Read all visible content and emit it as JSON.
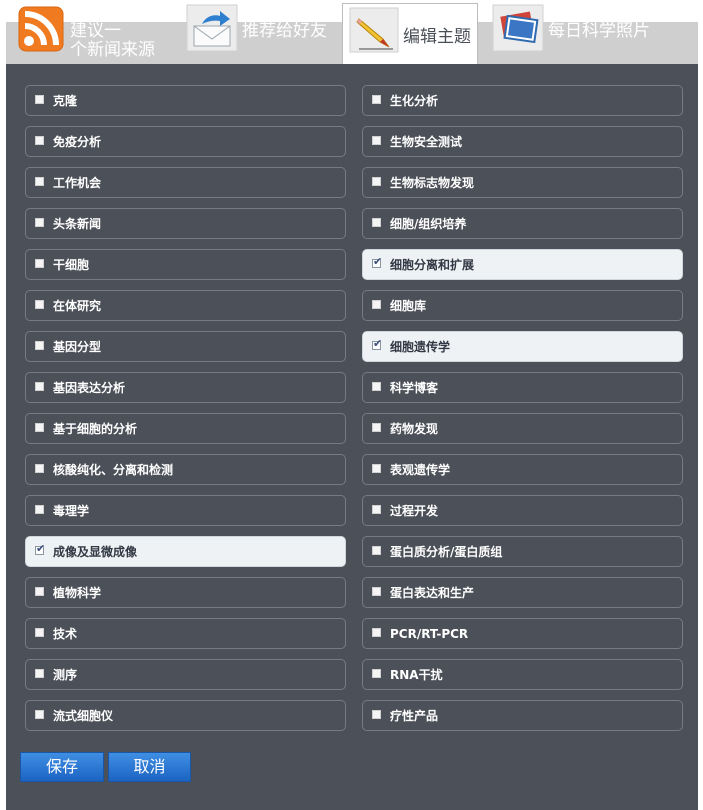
{
  "tabs": [
    {
      "line1": "建议一",
      "line2": "个新闻来源",
      "icon": "rss-icon"
    },
    {
      "label": "推荐给好友",
      "icon": "email-forward-icon"
    },
    {
      "label": "编辑主题",
      "icon": "pencil-icon",
      "active": true
    },
    {
      "label": "每日科学照片",
      "icon": "photo-icon"
    }
  ],
  "topics_left": [
    {
      "label": "克隆",
      "checked": false
    },
    {
      "label": "免疫分析",
      "checked": false
    },
    {
      "label": "工作机会",
      "checked": false
    },
    {
      "label": "头条新闻",
      "checked": false
    },
    {
      "label": "干细胞",
      "checked": false
    },
    {
      "label": "在体研究",
      "checked": false
    },
    {
      "label": "基因分型",
      "checked": false
    },
    {
      "label": "基因表达分析",
      "checked": false
    },
    {
      "label": "基于细胞的分析",
      "checked": false
    },
    {
      "label": "核酸纯化、分离和检测",
      "checked": false
    },
    {
      "label": "毒理学",
      "checked": false
    },
    {
      "label": "成像及显微成像",
      "checked": true
    },
    {
      "label": "植物科学",
      "checked": false
    },
    {
      "label": "技术",
      "checked": false
    },
    {
      "label": "测序",
      "checked": false
    },
    {
      "label": "流式细胞仪",
      "checked": false
    }
  ],
  "topics_right": [
    {
      "label": "生化分析",
      "checked": false
    },
    {
      "label": "生物安全测试",
      "checked": false
    },
    {
      "label": "生物标志物发现",
      "checked": false
    },
    {
      "label": "细胞/组织培养",
      "checked": false
    },
    {
      "label": "细胞分离和扩展",
      "checked": true
    },
    {
      "label": "细胞库",
      "checked": false
    },
    {
      "label": "细胞遗传学",
      "checked": true
    },
    {
      "label": "科学博客",
      "checked": false
    },
    {
      "label": "药物发现",
      "checked": false
    },
    {
      "label": "表观遗传学",
      "checked": false
    },
    {
      "label": "过程开发",
      "checked": false
    },
    {
      "label": "蛋白质分析/蛋白质组",
      "checked": false
    },
    {
      "label": "蛋白表达和生产",
      "checked": false
    },
    {
      "label": "PCR/RT-PCR",
      "checked": false
    },
    {
      "label": "RNA干扰",
      "checked": false
    },
    {
      "label": "疗性产品",
      "checked": false
    }
  ],
  "actions": {
    "save": "保存",
    "cancel": "取消"
  },
  "colors": {
    "panel": "#4c5058",
    "button": "#2a74d0",
    "tabstrip": "#cfcfcf"
  }
}
